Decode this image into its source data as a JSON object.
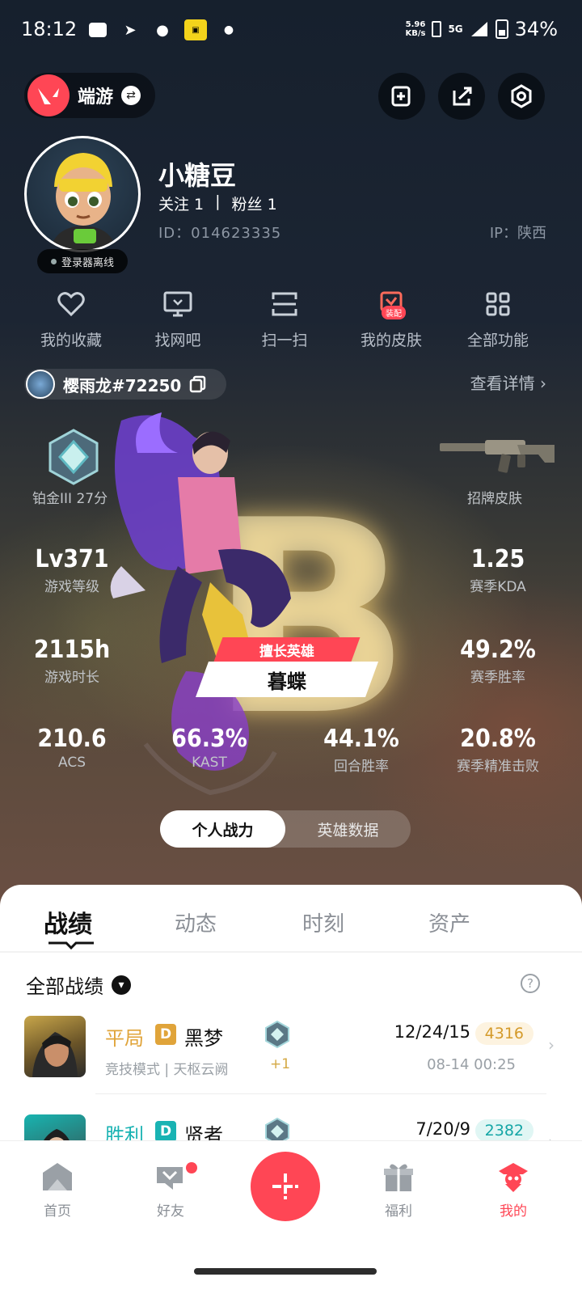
{
  "status_bar": {
    "time": "18:12",
    "net_speed_top": "5.96",
    "net_speed_bottom": "KB/s",
    "signal": "5G",
    "battery": "34%"
  },
  "top_bar": {
    "game_label": "端游",
    "swap_glyph": "⇄"
  },
  "profile": {
    "nickname": "小糖豆",
    "following": "关注 1",
    "divider": "|",
    "followers": "粉丝 1",
    "uid": "ID：014623335",
    "ip": "IP：陕西",
    "login_status": "登录器离线"
  },
  "functions": [
    {
      "label": "我的收藏",
      "icon": "heart-icon"
    },
    {
      "label": "找网吧",
      "icon": "monitor-icon"
    },
    {
      "label": "扫一扫",
      "icon": "scan-icon"
    },
    {
      "label": "我的皮肤",
      "icon": "skin-icon",
      "badge": "装配"
    },
    {
      "label": "全部功能",
      "icon": "grid-icon"
    }
  ],
  "riot": {
    "name": "樱雨龙#72250",
    "detail_link": "查看详情 ›"
  },
  "rank": {
    "label": "铂金III 27分"
  },
  "skin_label": "招牌皮肤",
  "grade_letter": "B",
  "stats": {
    "level_value": "Lv371",
    "level_label": "游戏等级",
    "kda_value": "1.25",
    "kda_label": "赛季KDA",
    "hours_value": "2115h",
    "hours_label": "游戏时长",
    "winrate_value": "49.2%",
    "winrate_label": "赛季胜率",
    "acs_value": "210.6",
    "acs_label": "ACS",
    "kast_value": "66.3%",
    "kast_label": "KAST",
    "round_win_value": "44.1%",
    "round_win_label": "回合胜率",
    "precise_value": "20.8%",
    "precise_label": "赛季精准击败"
  },
  "hero_tag": {
    "title": "擅长英雄",
    "name": "暮蝶"
  },
  "segment": {
    "left": "个人战力",
    "right": "英雄数据"
  },
  "tabs": [
    "战绩",
    "动态",
    "时刻",
    "资产"
  ],
  "filter": {
    "label": "全部战绩",
    "help": "?"
  },
  "matches": [
    {
      "result": "平局",
      "result_color": "#e0a43a",
      "rank_letter": "D",
      "rank_color": "#e0a43a",
      "map": "黑梦",
      "mode": "竞技模式 | 天枢云阙",
      "plus": "+1",
      "kda": "12/24/15",
      "score": "4316",
      "score_color": "#d49a2a",
      "score_bg": "#fdf3e0",
      "date": "08-14 00:25",
      "arrow": "›"
    },
    {
      "result": "胜利",
      "result_color": "#19b3b3",
      "rank_letter": "D",
      "rank_color": "#19b3b3",
      "map": "贤者",
      "kda": "7/20/9",
      "score": "2382",
      "score_color": "#14a6a6",
      "score_bg": "#e0f6f4",
      "arrow": "›"
    }
  ],
  "bottom_nav": {
    "home": "首页",
    "friends": "好友",
    "add": "+",
    "welfare": "福利",
    "mine": "我的"
  },
  "colors": {
    "accent": "#ff4655",
    "sheet": "#ffffff"
  }
}
